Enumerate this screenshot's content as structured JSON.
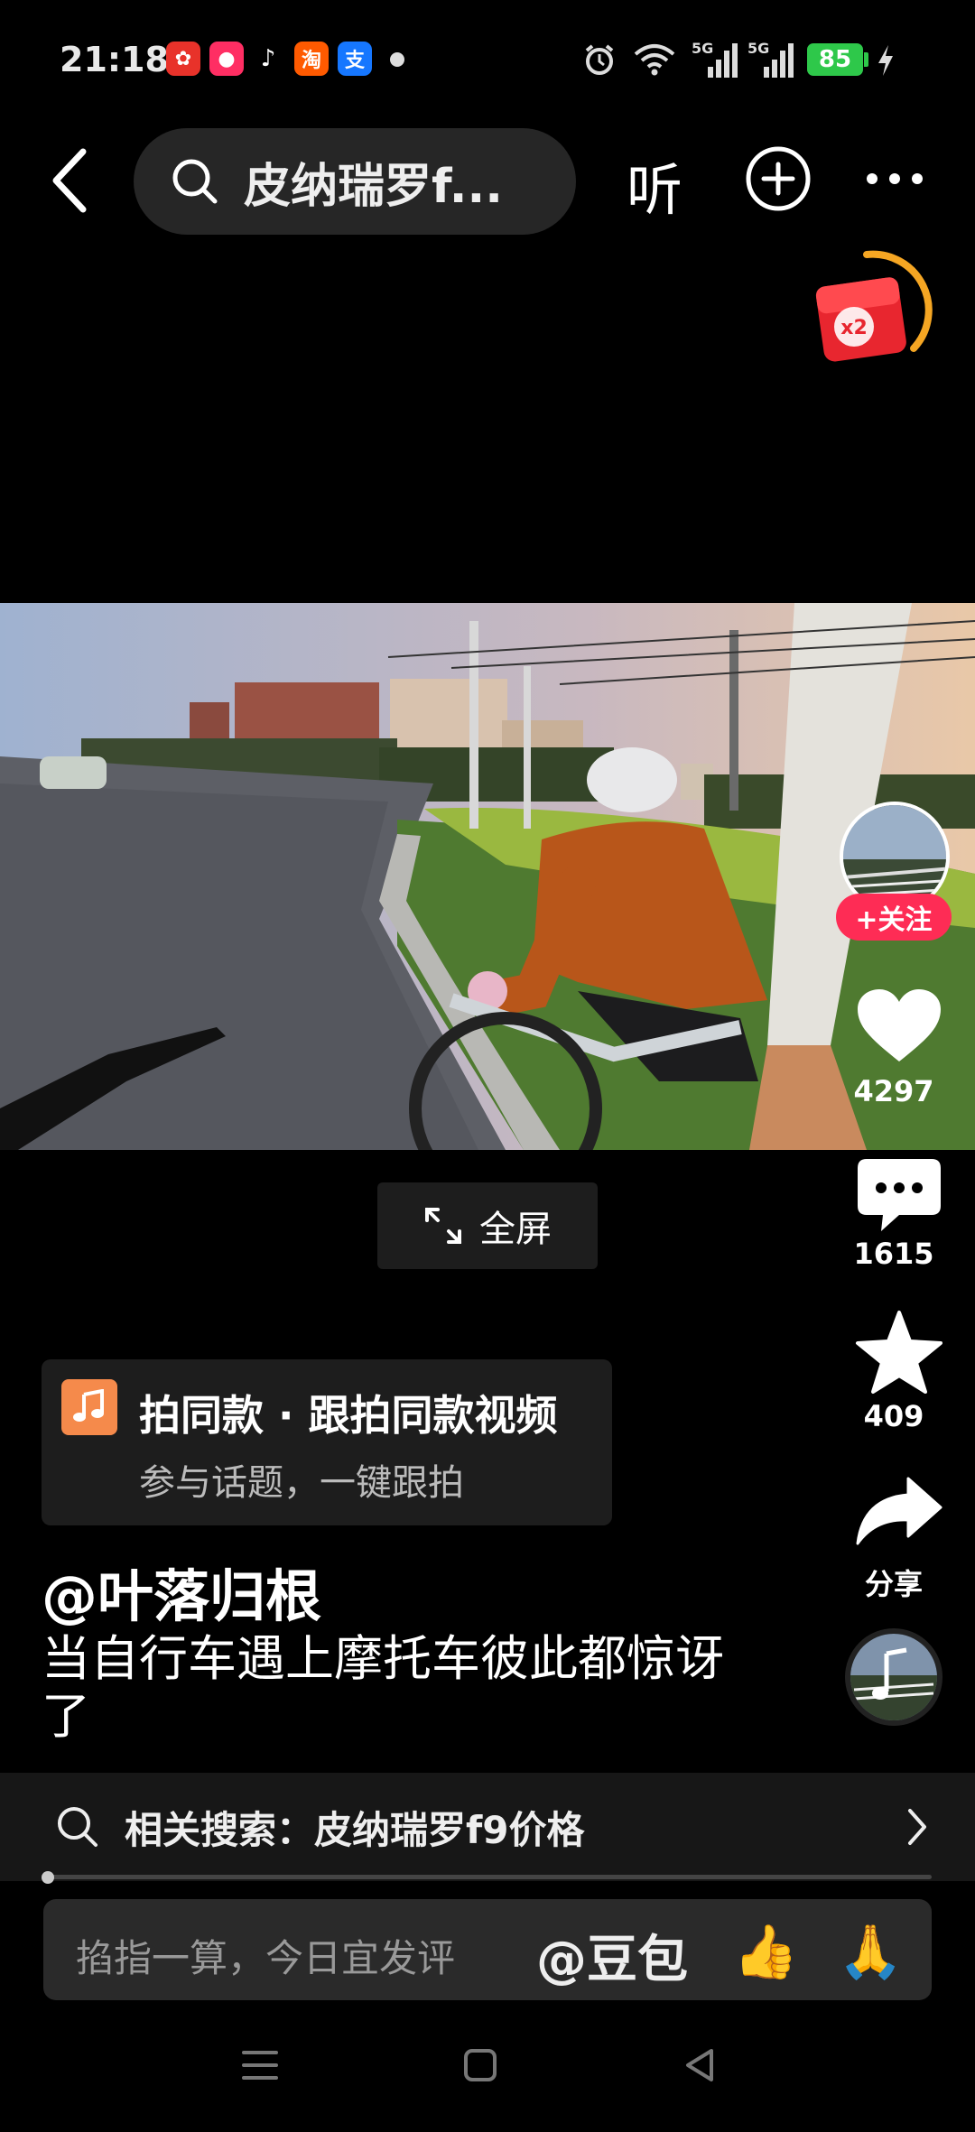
{
  "status": {
    "time": "21:18",
    "battery": "85",
    "signal1": "5G",
    "signal2": "5G"
  },
  "topbar": {
    "search_text": "皮纳瑞罗f...",
    "listen_label": "听"
  },
  "redpacket": {
    "multiplier": "x2"
  },
  "rail": {
    "follow_label": "+关注",
    "likes": "4297",
    "comments": "1615",
    "favorites": "409",
    "share_label": "分享"
  },
  "fullscreen_label": "全屏",
  "template_card": {
    "title": "拍同款 · 跟拍同款视频",
    "subtitle": "参与话题，一键跟拍"
  },
  "author": "@叶落归根",
  "caption": "当自行车遇上摩托车彼此都惊讶了",
  "related": {
    "prefix": "相关搜索：",
    "query": "皮纳瑞罗f9价格"
  },
  "progress_fraction": 0.005,
  "comment_bar": {
    "placeholder": "掐指一算，今日宜发评",
    "mention": "@豆包",
    "emoji1": "👍",
    "emoji2": "🙏"
  },
  "colors": {
    "accent": "#fe2c55",
    "battery": "#2ec84a",
    "music_icon": "#f58a4b"
  }
}
